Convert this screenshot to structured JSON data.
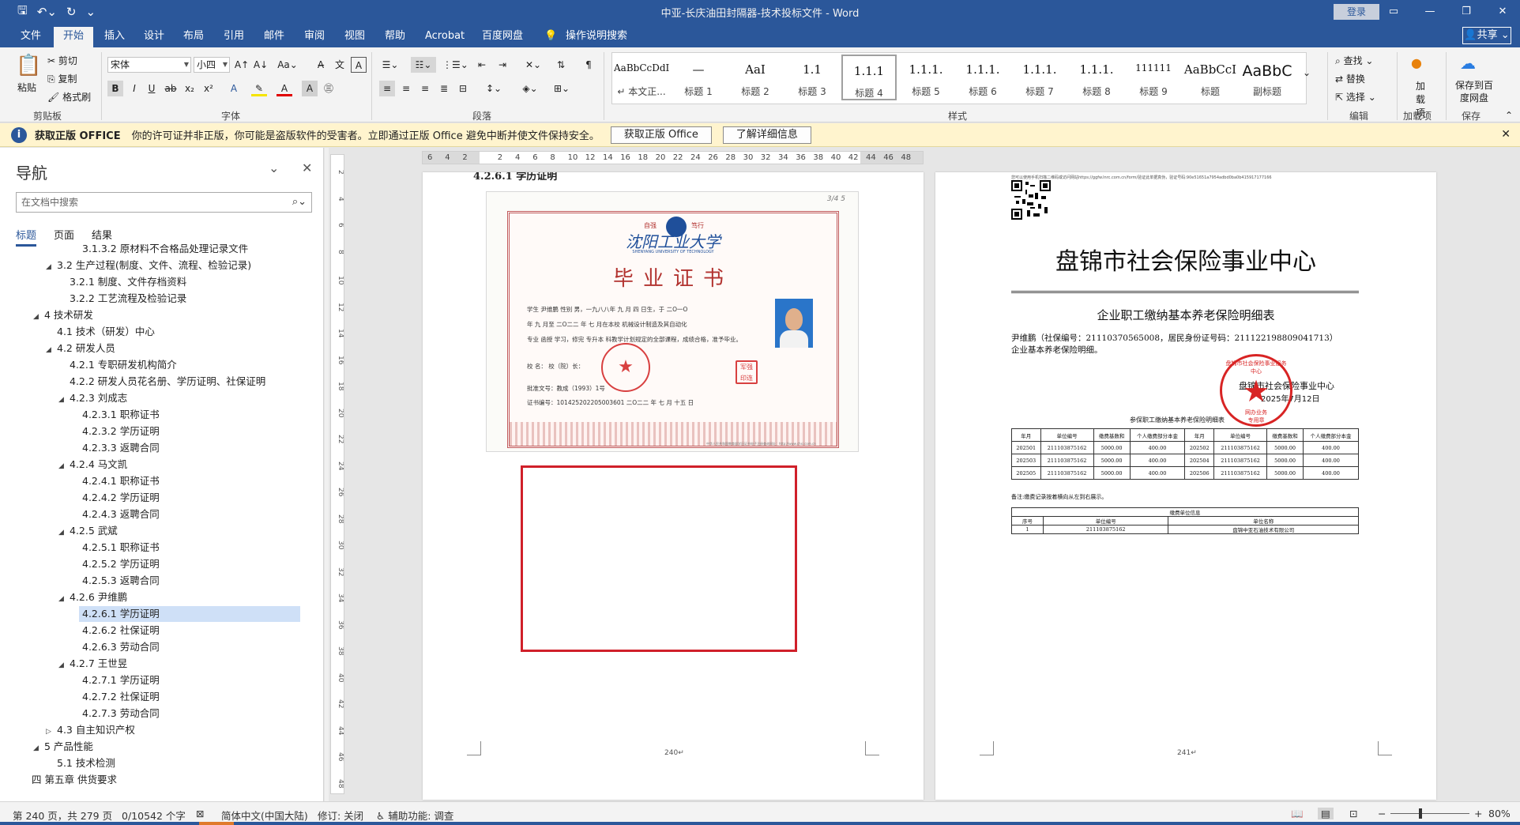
{
  "titlebar": {
    "title": "中亚-长庆油田封隔器-技术投标文件  -  Word",
    "login": "登录",
    "qat_icons": [
      "save-icon",
      "undo-icon",
      "redo-icon",
      "customize-icon"
    ]
  },
  "tabs": [
    "文件",
    "开始",
    "插入",
    "设计",
    "布局",
    "引用",
    "邮件",
    "审阅",
    "视图",
    "帮助",
    "Acrobat",
    "百度网盘",
    "操作说明搜索"
  ],
  "active_tab": "开始",
  "share": "共享",
  "ribbon": {
    "clipboard": {
      "paste": "粘贴",
      "cut": "剪切",
      "copy": "复制",
      "format_painter": "格式刷",
      "label": "剪贴板"
    },
    "font": {
      "name": "宋体",
      "size": "小四",
      "label": "字体"
    },
    "paragraph": {
      "label": "段落"
    },
    "styles": {
      "label": "样式",
      "items": [
        {
          "sample": "AaBbCcDdI",
          "name": "↵ 本文正..."
        },
        {
          "sample": "—",
          "name": "标题 1"
        },
        {
          "sample": "AaI",
          "name": "标题 2"
        },
        {
          "sample": "1.1",
          "name": "标题 3"
        },
        {
          "sample": "1.1.1",
          "name": "标题 4"
        },
        {
          "sample": "1.1.1.",
          "name": "标题 5"
        },
        {
          "sample": "1.1.1.",
          "name": "标题 6"
        },
        {
          "sample": "1.1.1.",
          "name": "标题 7"
        },
        {
          "sample": "1.1.1.",
          "name": "标题 8"
        },
        {
          "sample": "111111",
          "name": "标题 9"
        },
        {
          "sample": "AaBbCcI",
          "name": "标题"
        },
        {
          "sample": "AaBbC",
          "name": "副标题"
        }
      ]
    },
    "editing": {
      "find": "查找",
      "replace": "替换",
      "select": "选择",
      "label": "编辑"
    },
    "addins": {
      "btn": "加载项",
      "label": "加载项"
    },
    "save": {
      "btn": "保存到百度网盘",
      "label": "保存"
    }
  },
  "warning": {
    "title": "获取正版 OFFICE",
    "message": "你的许可证并非正版，你可能是盗版软件的受害者。立即通过正版 Office 避免中断并使文件保持安全。",
    "btn1": "获取正版 Office",
    "btn2": "了解详细信息"
  },
  "nav": {
    "title": "导航",
    "search_placeholder": "在文档中搜索",
    "tabs": [
      "标题",
      "页面",
      "结果"
    ],
    "items": [
      {
        "text": "3.1.3.2 原材料不合格品处理记录文件",
        "level": 3,
        "expand": ""
      },
      {
        "text": "3.2 生产过程(制度、文件、流程、检验记录)",
        "level": 1,
        "expand": "▲"
      },
      {
        "text": "3.2.1 制度、文件存档资料",
        "level": 2,
        "expand": ""
      },
      {
        "text": "3.2.2 工艺流程及检验记录",
        "level": 2,
        "expand": ""
      },
      {
        "text": "4 技术研发",
        "level": 0,
        "expand": "▲"
      },
      {
        "text": "4.1 技术（研发）中心",
        "level": 1,
        "expand": ""
      },
      {
        "text": "4.2 研发人员",
        "level": 1,
        "expand": "▲"
      },
      {
        "text": "4.2.1 专职研发机构简介",
        "level": 2,
        "expand": ""
      },
      {
        "text": "4.2.2 研发人员花名册、学历证明、社保证明",
        "level": 2,
        "expand": ""
      },
      {
        "text": "4.2.3 刘成志",
        "level": 2,
        "expand": "▲"
      },
      {
        "text": "4.2.3.1 职称证书",
        "level": 3,
        "expand": ""
      },
      {
        "text": "4.2.3.2 学历证明",
        "level": 3,
        "expand": ""
      },
      {
        "text": "4.2.3.3 返聘合同",
        "level": 3,
        "expand": ""
      },
      {
        "text": "4.2.4 马文凯",
        "level": 2,
        "expand": "▲"
      },
      {
        "text": "4.2.4.1 职称证书",
        "level": 3,
        "expand": ""
      },
      {
        "text": "4.2.4.2 学历证明",
        "level": 3,
        "expand": ""
      },
      {
        "text": "4.2.4.3 返聘合同",
        "level": 3,
        "expand": ""
      },
      {
        "text": "4.2.5 武斌",
        "level": 2,
        "expand": "▲"
      },
      {
        "text": "4.2.5.1 职称证书",
        "level": 3,
        "expand": ""
      },
      {
        "text": "4.2.5.2 学历证明",
        "level": 3,
        "expand": ""
      },
      {
        "text": "4.2.5.3 返聘合同",
        "level": 3,
        "expand": ""
      },
      {
        "text": "4.2.6 尹维鹏",
        "level": 2,
        "expand": "▲"
      },
      {
        "text": "4.2.6.1 学历证明",
        "level": 3,
        "expand": "",
        "selected": true
      },
      {
        "text": "4.2.6.2 社保证明",
        "level": 3,
        "expand": ""
      },
      {
        "text": "4.2.6.3 劳动合同",
        "level": 3,
        "expand": ""
      },
      {
        "text": "4.2.7 王世昱",
        "level": 2,
        "expand": "▲"
      },
      {
        "text": "4.2.7.1 学历证明",
        "level": 3,
        "expand": ""
      },
      {
        "text": "4.2.7.2 社保证明",
        "level": 3,
        "expand": ""
      },
      {
        "text": "4.2.7.3 劳动合同",
        "level": 3,
        "expand": ""
      },
      {
        "text": "4.3 自主知识产权",
        "level": 1,
        "expand": "▷"
      },
      {
        "text": "5 产品性能",
        "level": 0,
        "expand": "▲"
      },
      {
        "text": "5.1 技术检测",
        "level": 1,
        "expand": ""
      },
      {
        "text": "四 第五章 供货要求",
        "level": -1,
        "expand": ""
      }
    ]
  },
  "ruler": {
    "h_labels": [
      "6",
      "4",
      "2",
      "",
      "2",
      "4",
      "6",
      "8",
      "10",
      "12",
      "14",
      "16",
      "18",
      "20",
      "22",
      "24",
      "26",
      "28",
      "30",
      "32",
      "34",
      "36",
      "38",
      "40",
      "42",
      "44",
      "46",
      "48"
    ],
    "v_labels": [
      "2",
      "4",
      "6",
      "8",
      "10",
      "12",
      "14",
      "16",
      "18",
      "20",
      "22",
      "24",
      "26",
      "28",
      "30",
      "32",
      "34",
      "36",
      "38",
      "40",
      "42",
      "44",
      "46",
      "48"
    ]
  },
  "page1": {
    "heading": "4.2.6.1 学历证明",
    "page_number": "240",
    "certificate": {
      "school_cn": "沈阳工业大学",
      "school_en": "SHENYANG UNIVERSITY OF TECHNOLOGY",
      "title": "毕业证书",
      "top_note": "3/4 5",
      "line1": "学生    尹维鹏    性别 男，一九八八年 九 月  四  日生，于 二O一O",
      "line2": "年 九 月至 二O二二 年 七 月在本校      机械设计制造及其自动化",
      "line3": "专业 函授 学习，修完  专升本  科教学计划规定的全部课程，成绩合格，准予毕业。",
      "line4": "校  名：                                      校（院）长：",
      "line5": "批准文号：教成（1993）1号",
      "line6": "证书编号：101425202205003601                 二O二二 年  七  月 十五 日",
      "footer": "中华人民共和国教育部学历证书电子注册查询网址：http://www.chsi.com.cn",
      "seal_text": "毕业证书专用章"
    }
  },
  "page2": {
    "top_note": "您可以使用手机扫描二维码或访问网站https://ggfw.lnrc.com.cn/form/验证此单据真伪，验证号码:90e51651a7954adbd0ba0b415917177166",
    "org_title": "盘锦市社会保险事业中心",
    "subtitle": "企业职工缴纳基本养老保险明细表",
    "line1": "尹维鹏（社保编号：21110370565008，居民身份证号码：211122198809041713）",
    "line2": "企业基本养老保险明细。",
    "sign_org": "盘锦市社会保险事业中心",
    "sign_date": "2025年7月12日",
    "table_caption": "参保职工缴纳基本养老保险明细表",
    "stamp_arc": "盘锦市社会保险事业服务中心",
    "stamp_t1": "网办业务",
    "stamp_t2": "专用章",
    "headers": [
      "年月",
      "单位编号",
      "缴费基数和",
      "个人缴费部分本金",
      "年月",
      "单位编号",
      "缴费基数和",
      "个人缴费部分本金"
    ],
    "rows": [
      [
        "202501",
        "211103875162",
        "5000.00",
        "400.00",
        "202502",
        "211103875162",
        "5000.00",
        "400.00"
      ],
      [
        "202503",
        "211103875162",
        "5000.00",
        "400.00",
        "202504",
        "211103875162",
        "5000.00",
        "400.00"
      ],
      [
        "202505",
        "211103875162",
        "5000.00",
        "400.00",
        "202506",
        "211103875162",
        "5000.00",
        "400.00"
      ]
    ],
    "note": "备注:缴费记录按着横向从左到右展示。",
    "unit_caption": "缴费单位信息",
    "unit_headers": [
      "序号",
      "单位编号",
      "单位名称"
    ],
    "unit_row": [
      "1",
      "211103875162",
      "盘锦中亚石油技术有限公司"
    ],
    "page_number": "241"
  },
  "status": {
    "page": "第 240 页，共 279 页",
    "words": "0/10542 个字",
    "lang": "简体中文(中国大陆)",
    "track": "修订: 关闭",
    "access": "辅助功能: 调查",
    "zoom": "80%"
  }
}
